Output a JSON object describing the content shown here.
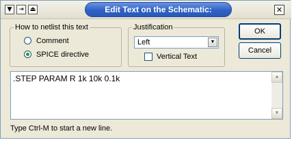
{
  "window": {
    "title": "Edit Text on the Schematic:",
    "title_buttons": [
      "pin-icon",
      "minimize-to-tray-icon",
      "eject-icon"
    ],
    "close_glyph": "✕"
  },
  "netlist_group": {
    "legend": "How to netlist this text",
    "options": [
      {
        "label": "Comment",
        "selected": false
      },
      {
        "label": "SPICE directive",
        "selected": true
      }
    ]
  },
  "justification_group": {
    "legend": "Justification",
    "selected": "Left",
    "vertical_text_label": "Vertical Text",
    "vertical_text_checked": false
  },
  "buttons": {
    "ok": "OK",
    "cancel": "Cancel"
  },
  "text_editor": {
    "content": ".STEP PARAM R 1k 10k 0.1k"
  },
  "hint": "Type Ctrl-M to start a new line.",
  "colors": {
    "title_bar_accent": "#2f62c6",
    "dialog_bg": "#ece9d8",
    "radio_selected": "#21a121"
  }
}
